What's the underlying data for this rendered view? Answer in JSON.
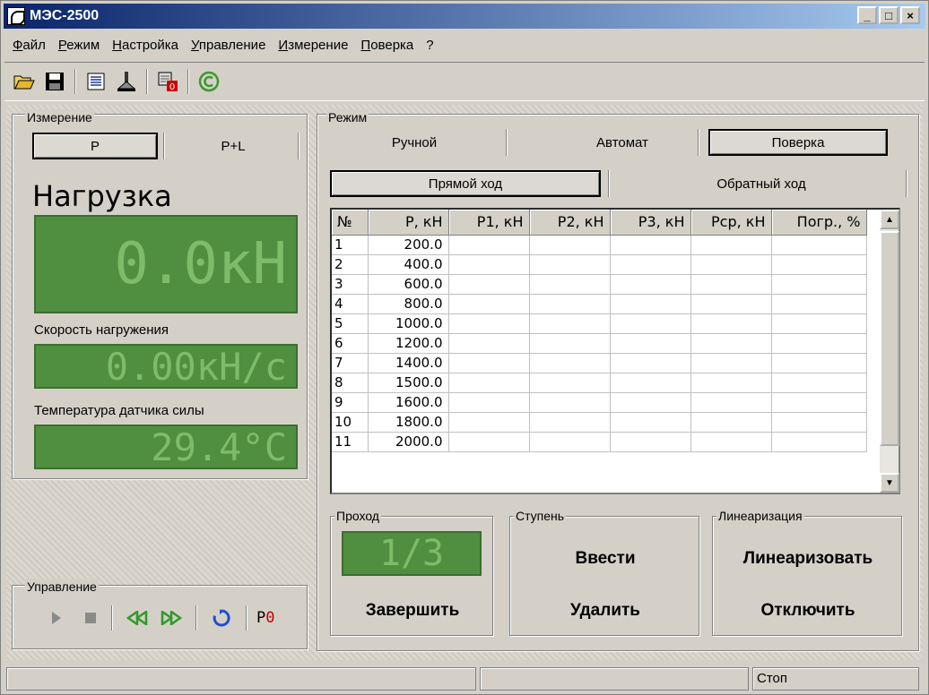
{
  "window": {
    "title": "МЭС-2500",
    "btn_min": "_",
    "btn_max": "□",
    "btn_close": "×"
  },
  "menu": [
    "Файл",
    "Режим",
    "Настройка",
    "Управление",
    "Измерение",
    "Поверка",
    "?"
  ],
  "toolbar": [
    "open-folder-icon",
    "save-icon",
    "report-icon",
    "print-icon",
    "reset-counter-icon",
    "copyright-icon"
  ],
  "measurement": {
    "group_label": "Измерение",
    "tab_p": "P",
    "tab_pl": "P+L",
    "load_title": "Нагрузка",
    "load_value": "0.0кН",
    "speed_label": "Скорость нагружения",
    "speed_value": "0.00кН/с",
    "temp_label": "Температура датчика силы",
    "temp_value": "29.4°C"
  },
  "control": {
    "group_label": "Управление",
    "p0_label": "P0"
  },
  "mode": {
    "group_label": "Режим",
    "tabs": [
      "Ручной",
      "Автомат",
      "Поверка"
    ],
    "active_tab": "Поверка",
    "direction_tabs": [
      "Прямой ход",
      "Обратный ход"
    ],
    "active_direction": "Прямой ход"
  },
  "table": {
    "columns": [
      "№",
      "P, кН",
      "P1, кН",
      "P2, кН",
      "P3, кН",
      "Pср, кН",
      "Погр., %"
    ],
    "rows": [
      [
        "1",
        "200.0",
        "",
        "",
        "",
        "",
        ""
      ],
      [
        "2",
        "400.0",
        "",
        "",
        "",
        "",
        ""
      ],
      [
        "3",
        "600.0",
        "",
        "",
        "",
        "",
        ""
      ],
      [
        "4",
        "800.0",
        "",
        "",
        "",
        "",
        ""
      ],
      [
        "5",
        "1000.0",
        "",
        "",
        "",
        "",
        ""
      ],
      [
        "6",
        "1200.0",
        "",
        "",
        "",
        "",
        ""
      ],
      [
        "7",
        "1400.0",
        "",
        "",
        "",
        "",
        ""
      ],
      [
        "8",
        "1500.0",
        "",
        "",
        "",
        "",
        ""
      ],
      [
        "9",
        "1600.0",
        "",
        "",
        "",
        "",
        ""
      ],
      [
        "10",
        "1800.0",
        "",
        "",
        "",
        "",
        ""
      ],
      [
        "11",
        "2000.0",
        "",
        "",
        "",
        "",
        ""
      ]
    ]
  },
  "pass": {
    "group_label": "Проход",
    "value": "1/3",
    "finish_button": "Завершить"
  },
  "step": {
    "group_label": "Ступень",
    "enter_button": "Ввести",
    "delete_button": "Удалить"
  },
  "linearization": {
    "group_label": "Линеаризация",
    "linearize_button": "Линеаризовать",
    "disable_button": "Отключить"
  },
  "status": {
    "pane3": "Стоп"
  },
  "colors": {
    "lcd_bg": "#4f8f3f",
    "lcd_text": "#7ebc6a",
    "title_start": "#0a246a",
    "title_end": "#a6caf0"
  }
}
